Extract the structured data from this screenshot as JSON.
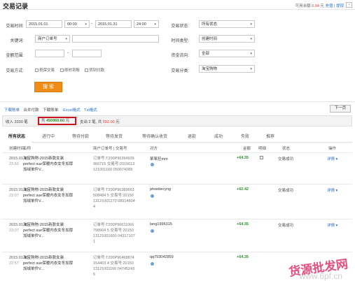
{
  "header": {
    "title": "交易记录",
    "balance_label": "可用余额",
    "balance_value": "0.04",
    "balance_unit": "元",
    "topup_link": "充值",
    "withdraw_link": "提现"
  },
  "filters": {
    "time_label": "交易时间:",
    "date_start": "2015.01.01",
    "time_start": "00:00",
    "dash": "-",
    "date_end": "2015.01.31",
    "time_end": "24:00",
    "status_label": "交易状态:",
    "status_value": "所有状态",
    "keyword_label": "关键词:",
    "keyword_type": "商户订单号",
    "keyword_value": "",
    "time_type_label": "时间类型:",
    "time_type_value": "创建时间",
    "amount_label": "金额范围:",
    "amount_min": "",
    "amount_max": "",
    "flow_label": "资金流向:",
    "flow_value": "全部",
    "method_label": "交易方式:",
    "method_options": [
      "担保交易",
      "即时到账",
      "货到付款"
    ],
    "category_label": "交易分类:",
    "category_value": "淘宝购物",
    "search_button": "搜 索"
  },
  "toolbar": {
    "download_link": "下载账单",
    "merge_pay": "合并付款",
    "download_bill": "下载账单:",
    "excel": "Excel格式",
    "txt": "Txt格式",
    "next_page": "下一页"
  },
  "summary": {
    "income_text": "收入 3330 笔",
    "income_amount_prefix": "共",
    "income_amount": "450960.60",
    "income_unit": "元",
    "expense_text": "支出 2 笔,",
    "expense_prefix": "共",
    "expense_amount": "592.00",
    "expense_unit": "元"
  },
  "tabs": [
    "所有状态",
    "进行中",
    "等待付款",
    "等待发货",
    "等待确认收货",
    "退款",
    "成功",
    "失败",
    "推荐"
  ],
  "columns": [
    "创建时间",
    "名称",
    "商户订单号 | 交易号",
    "对方",
    "金额",
    "明细",
    "状态",
    "操作"
  ],
  "rows": [
    {
      "date": "2015.01.31",
      "time": "23:50",
      "name": "淘宝购物-2015新款女装perfect sue保暖内衣女冬加厚加绒单件V...",
      "order": "订单号:T200P96394939966715 交易号:2015013121001160 050674289",
      "peer": "笨笨狂mm",
      "amount": "+64.35",
      "status": "交易成功",
      "action": "详情 ▾"
    },
    {
      "date": "2015.01.31",
      "time": "23:07",
      "name": "淘宝购物-2015新款女装perfect sue保暖内衣女冬加厚加绒单件V...",
      "order": "订单号:T200P96389663508484 5 交易号:2015013121001270 089146044",
      "peer": "phoebecyng",
      "amount": "+62.42",
      "status": "交易成功",
      "action": "详情 ▾"
    },
    {
      "date": "2015.01.31",
      "time": "23:07",
      "name": "淘宝购物-2015新款女装perfect sue保暖内衣女冬加厚加绒单件V...",
      "order": "订单号:T200P96611066798904 5 交易号:2015013121001600 043171071",
      "peer": "lang1996315",
      "amount": "+64.35",
      "status": "交易成功",
      "action": "详情 ▾"
    },
    {
      "date": "2015.01.31",
      "time": "22:57",
      "name": "淘宝购物-2015新款女装perfect sue保暖内衣女冬加厚加绒单件V...",
      "order": "订单号:T200P96468874154403 4 交易号:2015013121001160 047452436",
      "peer": "qq793042859",
      "amount": "+64.35",
      "status": "交易成功",
      "action": "详情 ▾"
    }
  ],
  "watermark": {
    "main": "货源批发网",
    "sub": "www.6pf.cn"
  },
  "colors": {
    "accent_orange": "#f08c18",
    "income_green": "#2e8b2e",
    "highlight_red": "#c9151e",
    "link_blue": "#2b6cc4"
  }
}
